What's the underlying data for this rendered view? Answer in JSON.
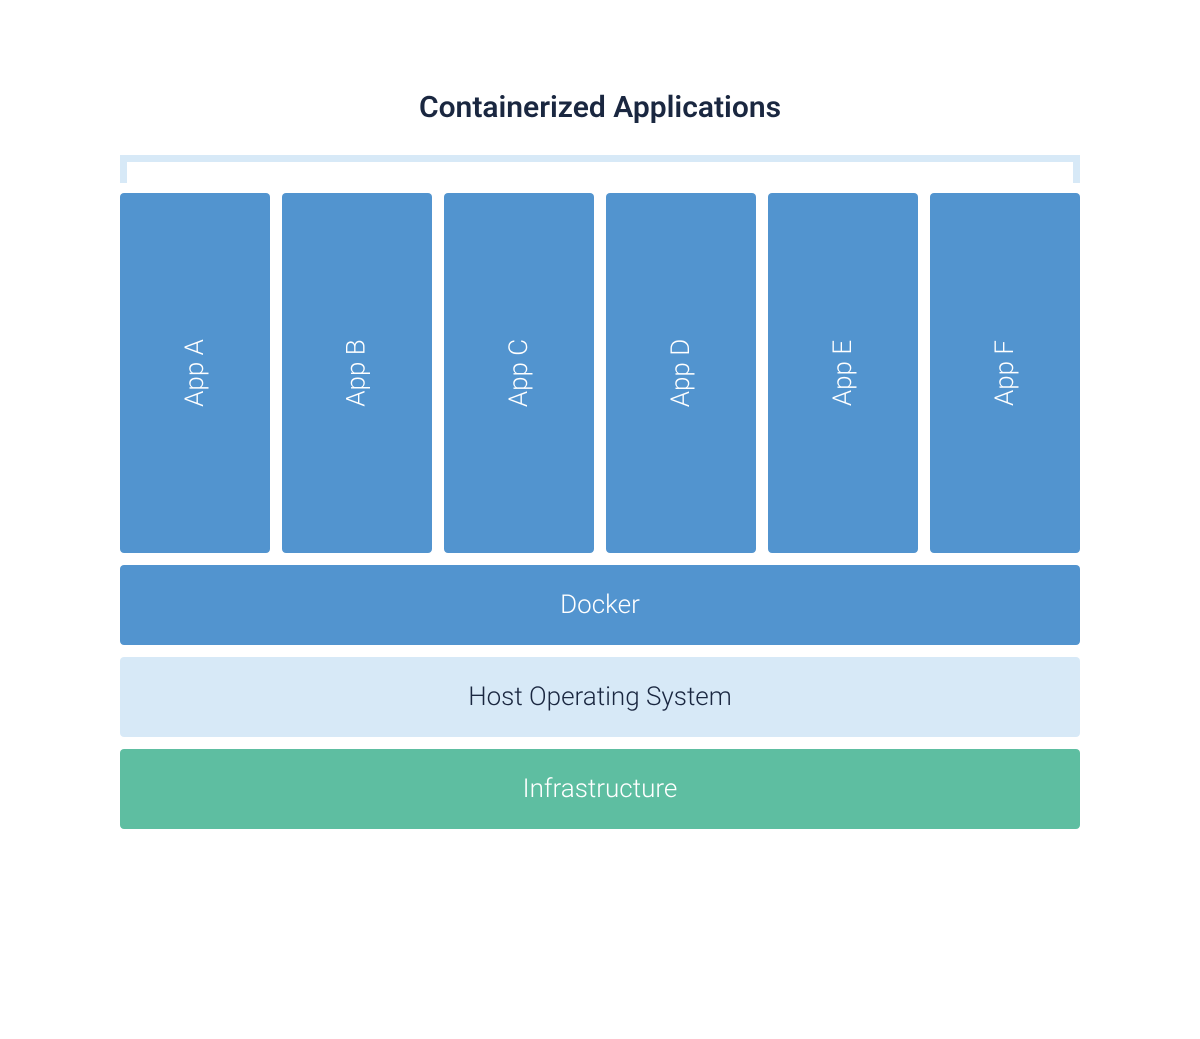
{
  "title": "Containerized Applications",
  "apps": [
    {
      "label": "App A"
    },
    {
      "label": "App B"
    },
    {
      "label": "App C"
    },
    {
      "label": "App D"
    },
    {
      "label": "App E"
    },
    {
      "label": "App F"
    }
  ],
  "layers": {
    "docker": "Docker",
    "host": "Host Operating System",
    "infrastructure": "Infrastructure"
  },
  "colors": {
    "app_box": "#5294cf",
    "docker_layer": "#5294cf",
    "host_layer": "#d7e9f7",
    "infrastructure_layer": "#5ebea1",
    "title_text": "#1a2740",
    "bracket": "#d7e9f7"
  }
}
